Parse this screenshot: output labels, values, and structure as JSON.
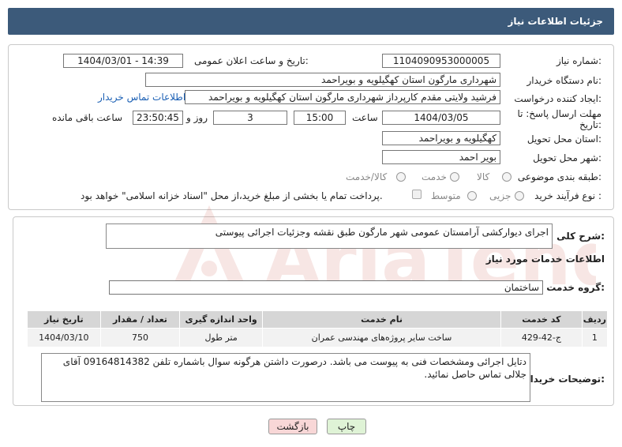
{
  "header": {
    "title": "جزئیات اطلاعات نیاز"
  },
  "fields": {
    "need_number_label": "شماره نیاز:",
    "need_number_value": "1104090953000005",
    "announce_label": "تاریخ و ساعت اعلان عمومی:",
    "announce_value": "1404/03/01 - 14:39",
    "buyer_org_label": "نام دستگاه خریدار:",
    "buyer_org_value": "شهرداری مارگون استان کهگیلویه و بویراحمد",
    "creator_label": "ایجاد کننده درخواست:",
    "creator_value": "فرشید  ولایتی مقدم  کارپرداز شهرداری مارگون استان کهگیلویه و بویراحمد",
    "buyer_contact_link": "اطلاعات تماس خریدار",
    "deadline_label_1": "مهلت ارسال پاسخ: تا",
    "deadline_label_2": "تاریخ:",
    "deadline_date": "1404/03/05",
    "time_label": "ساعت",
    "deadline_time": "15:00",
    "days_value": "3",
    "days_label": "روز و",
    "remaining_time": "23:50:45",
    "remaining_label": "ساعت باقی مانده",
    "province_label": "استان محل تحویل:",
    "province_value": "کهگیلویه و بویراحمد",
    "city_label": "شهر محل تحویل:",
    "city_value": "بویر احمد",
    "category_label": "طبقه بندی موضوعی:",
    "category_options": [
      "کالا",
      "خدمت",
      "کالا/خدمت"
    ],
    "process_label": "نوع فرآیند خرید :",
    "process_options": [
      "جزیی",
      "متوسط"
    ],
    "payment_note": "پرداخت تمام یا بخشی از مبلغ خرید،از محل \"اسناد خزانه اسلامی\" خواهد بود."
  },
  "summary": {
    "label": "شرح کلی نیاز:",
    "value": "اجرای دیوارکشی آرامستان عمومی شهر مارگون طبق نقشه وجزئیات اجرائی پیوستی"
  },
  "services": {
    "section_title": "اطلاعات خدمات مورد نیاز",
    "group_label": "گروه خدمت:",
    "group_value": "ساختمان",
    "columns": [
      "ردیف",
      "کد خدمت",
      "نام خدمت",
      "واحد اندازه گیری",
      "تعداد / مقدار",
      "تاریخ نیاز"
    ],
    "rows": [
      [
        "1",
        "ج-42-429",
        "ساخت سایر پروژه‌های مهندسی عمران",
        "متر طول",
        "750",
        "1404/03/10"
      ]
    ]
  },
  "buyer_notes": {
    "label": "توضیحات خریدار:",
    "value": "دتایل اجرائی ومشخصات فنی به پیوست می باشد. درصورت داشتن هرگونه سوال باشماره تلفن 09164814382 آقای جلالی تماس حاصل نمائید."
  },
  "buttons": {
    "print": "چاپ",
    "back": "بازگشت"
  },
  "colors": {
    "header_bg": "#3c5a7a",
    "link": "#1a5fb4",
    "back_btn_bg": "#f8d7d7",
    "print_btn_bg": "#dff3d6",
    "watermark": "#c0392b"
  }
}
